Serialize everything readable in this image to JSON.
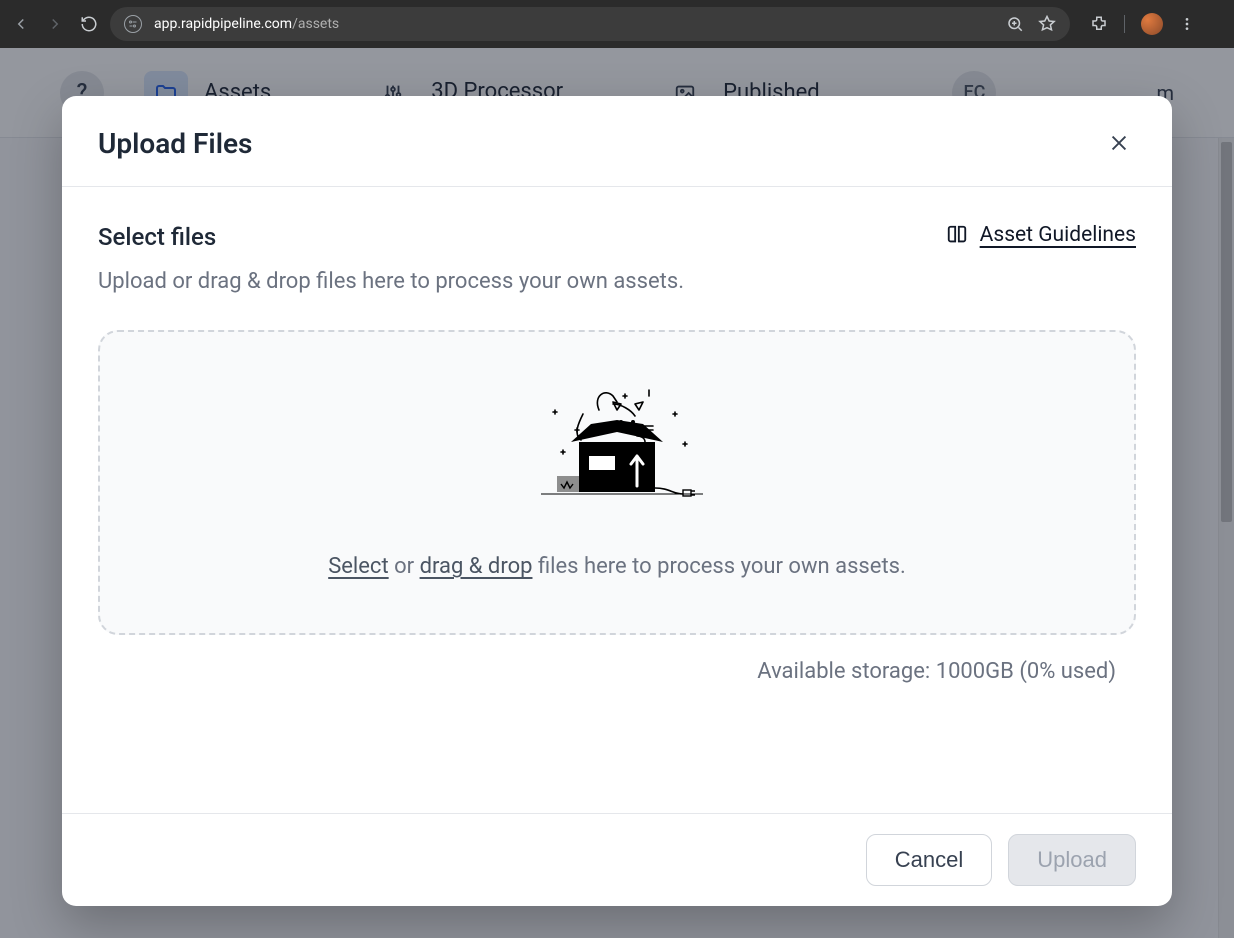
{
  "browser": {
    "url_domain": "app.rapidpipeline.com",
    "url_path": "/assets"
  },
  "header": {
    "help": "?",
    "nav": [
      {
        "label": "Assets"
      },
      {
        "label": "3D Processor"
      },
      {
        "label": "Published"
      }
    ],
    "avatar_initials": "EC",
    "partial_right_text": "m"
  },
  "modal": {
    "title": "Upload Files",
    "section_title": "Select files",
    "guidelines_label": "Asset Guidelines",
    "subtitle": "Upload or drag & drop files here to process your own assets.",
    "dropzone": {
      "select": "Select",
      "or": " or ",
      "dragdrop": "drag & drop",
      "rest": " files here to process your own assets."
    },
    "storage": {
      "label_prefix": "Available storage: ",
      "amount": "1000GB",
      "usage": " (0% used)"
    },
    "buttons": {
      "cancel": "Cancel",
      "upload": "Upload"
    }
  }
}
